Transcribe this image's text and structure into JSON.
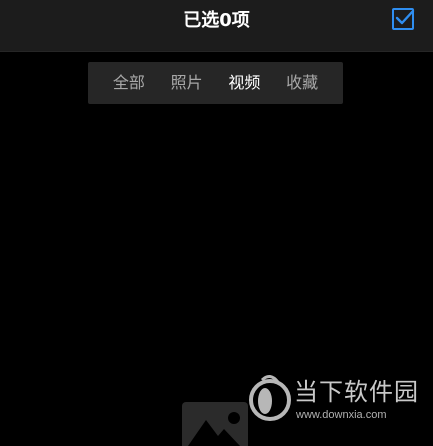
{
  "header": {
    "title": "已选0项",
    "select_all_icon": "checkbox-checked-icon",
    "accent_color": "#2f8ef0"
  },
  "filter": {
    "tabs": [
      {
        "label": "全部",
        "active": false
      },
      {
        "label": "照片",
        "active": false
      },
      {
        "label": "视频",
        "active": true
      },
      {
        "label": "收藏",
        "active": false
      }
    ]
  },
  "placeholder": {
    "icon": "image-placeholder-icon"
  },
  "watermark": {
    "name": "当下软件园",
    "url": "www.downxia.com",
    "icon": "downxia-logo-icon"
  }
}
